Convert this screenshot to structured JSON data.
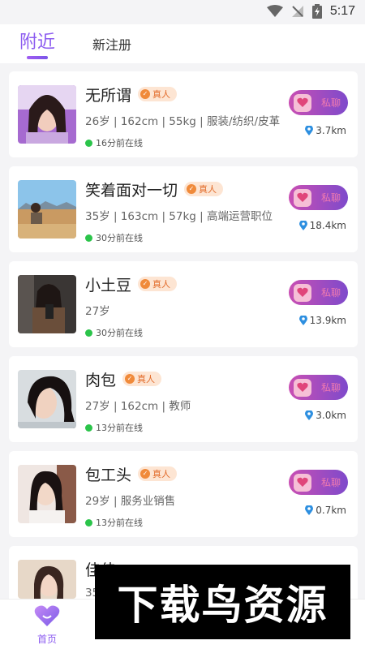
{
  "status_bar": {
    "time": "5:17"
  },
  "tabs": [
    {
      "label": "附近"
    },
    {
      "label": "新注册"
    }
  ],
  "users": [
    {
      "name": "无所谓",
      "badge": "真人",
      "details": "26岁 | 162cm | 55kg | 服装/纺织/皮革",
      "online": "16分前在线",
      "chat_label": "私聊",
      "distance": "3.7km"
    },
    {
      "name": "笑着面对一切",
      "badge": "真人",
      "details": "35岁 | 163cm | 57kg | 高端运营职位",
      "online": "30分前在线",
      "chat_label": "私聊",
      "distance": "18.4km"
    },
    {
      "name": "小土豆",
      "badge": "真人",
      "details": "27岁",
      "online": "30分前在线",
      "chat_label": "私聊",
      "distance": "13.9km"
    },
    {
      "name": "肉包",
      "badge": "真人",
      "details": "27岁 | 162cm | 教师",
      "online": "13分前在线",
      "chat_label": "私聊",
      "distance": "3.0km"
    },
    {
      "name": "包工头",
      "badge": "真人",
      "details": "29岁 | 服务业销售",
      "online": "13分前在线",
      "chat_label": "私聊",
      "distance": "0.7km"
    },
    {
      "name": "佳佳",
      "badge": "",
      "details": "35",
      "online": "",
      "chat_label": "",
      "distance": ""
    }
  ],
  "bottom_nav": {
    "home_label": "首页"
  },
  "watermark": {
    "text": "下载鸟资源"
  },
  "colors": {
    "accent": "#8c5cf0",
    "online": "#2bc44a",
    "badge_bg": "#fde5d3",
    "badge_text": "#e26b2a"
  }
}
